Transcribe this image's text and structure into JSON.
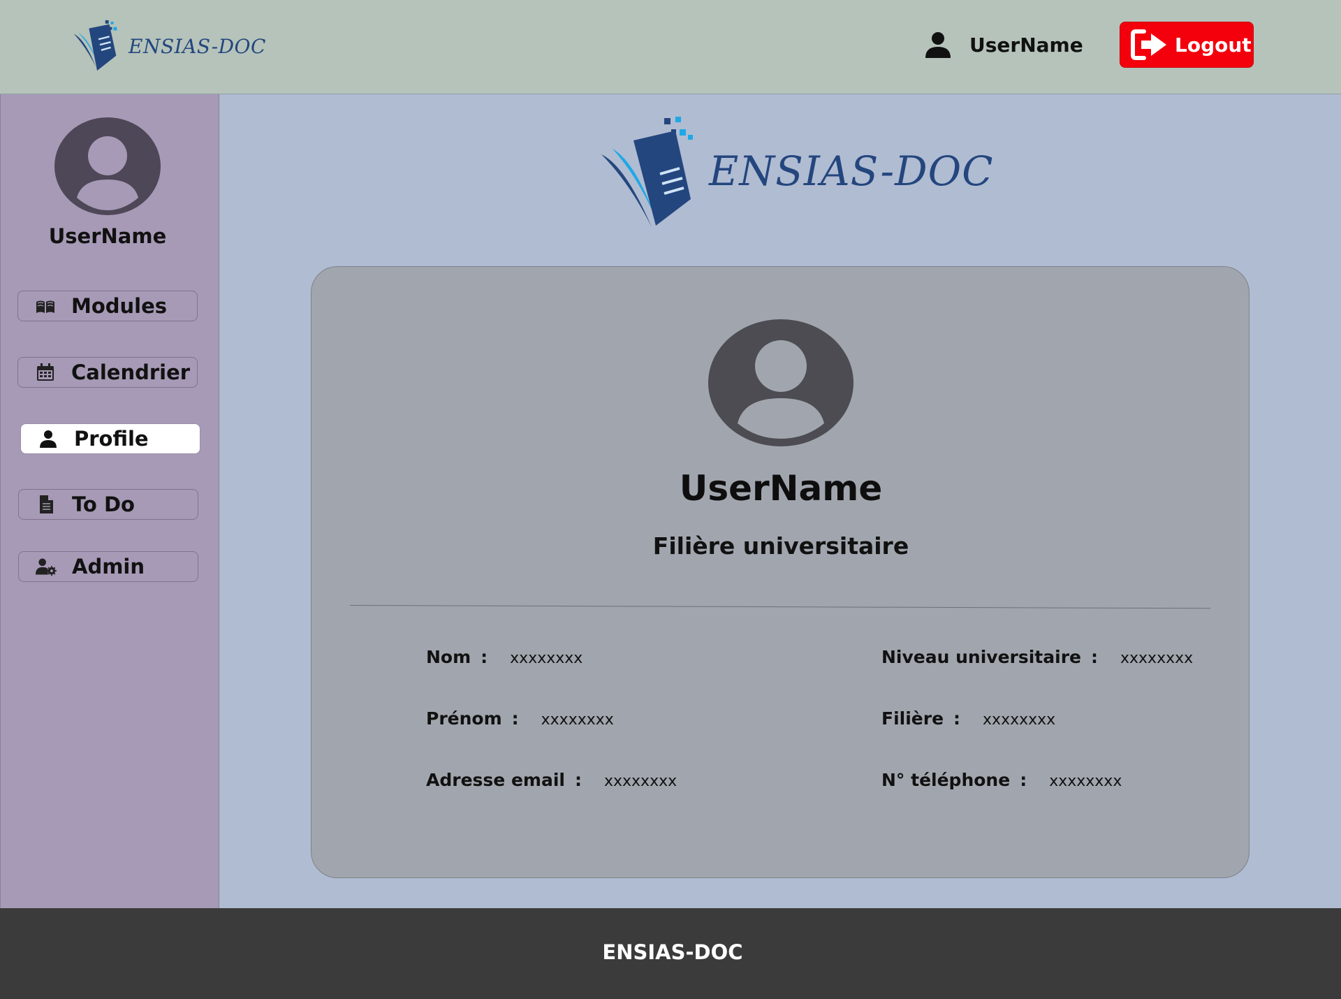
{
  "brand": {
    "name": "ENSIAS-DOC",
    "color": "#24467e",
    "accent": "#1ea8e6"
  },
  "header": {
    "username": "UserName",
    "logout_label": "Logout",
    "logout_color": "#f4000d"
  },
  "sidebar": {
    "username": "UserName",
    "items": [
      {
        "label": "Modules",
        "icon": "book-open-icon",
        "active": false
      },
      {
        "label": "Calendrier",
        "icon": "calendar-icon",
        "active": false
      },
      {
        "label": "Profile",
        "icon": "user-icon",
        "active": true
      },
      {
        "label": "To Do",
        "icon": "file-text-icon",
        "active": false
      },
      {
        "label": "Admin",
        "icon": "user-cog-icon",
        "active": false
      }
    ]
  },
  "profile": {
    "username": "UserName",
    "filiere": "Filière universitaire",
    "fields": {
      "nom": {
        "label": "Nom",
        "value": "xxxxxxxx"
      },
      "prenom": {
        "label": "Prénom",
        "value": "xxxxxxxx"
      },
      "email": {
        "label": "Adresse email",
        "value": "xxxxxxxx"
      },
      "niveau": {
        "label": "Niveau universitaire",
        "value": "xxxxxxxx"
      },
      "filiere": {
        "label": "Filière",
        "value": "xxxxxxxx"
      },
      "telephone": {
        "label": "N° téléphone",
        "value": "xxxxxxxx"
      }
    }
  },
  "footer": {
    "text": "ENSIAS-DOC"
  },
  "colors": {
    "header_bg": "#b5c3ba",
    "sidebar_bg": "#a79ab6",
    "main_bg": "#b0bcd2",
    "card_bg": "#a1a6ae",
    "footer_bg": "#3b3b3b"
  }
}
